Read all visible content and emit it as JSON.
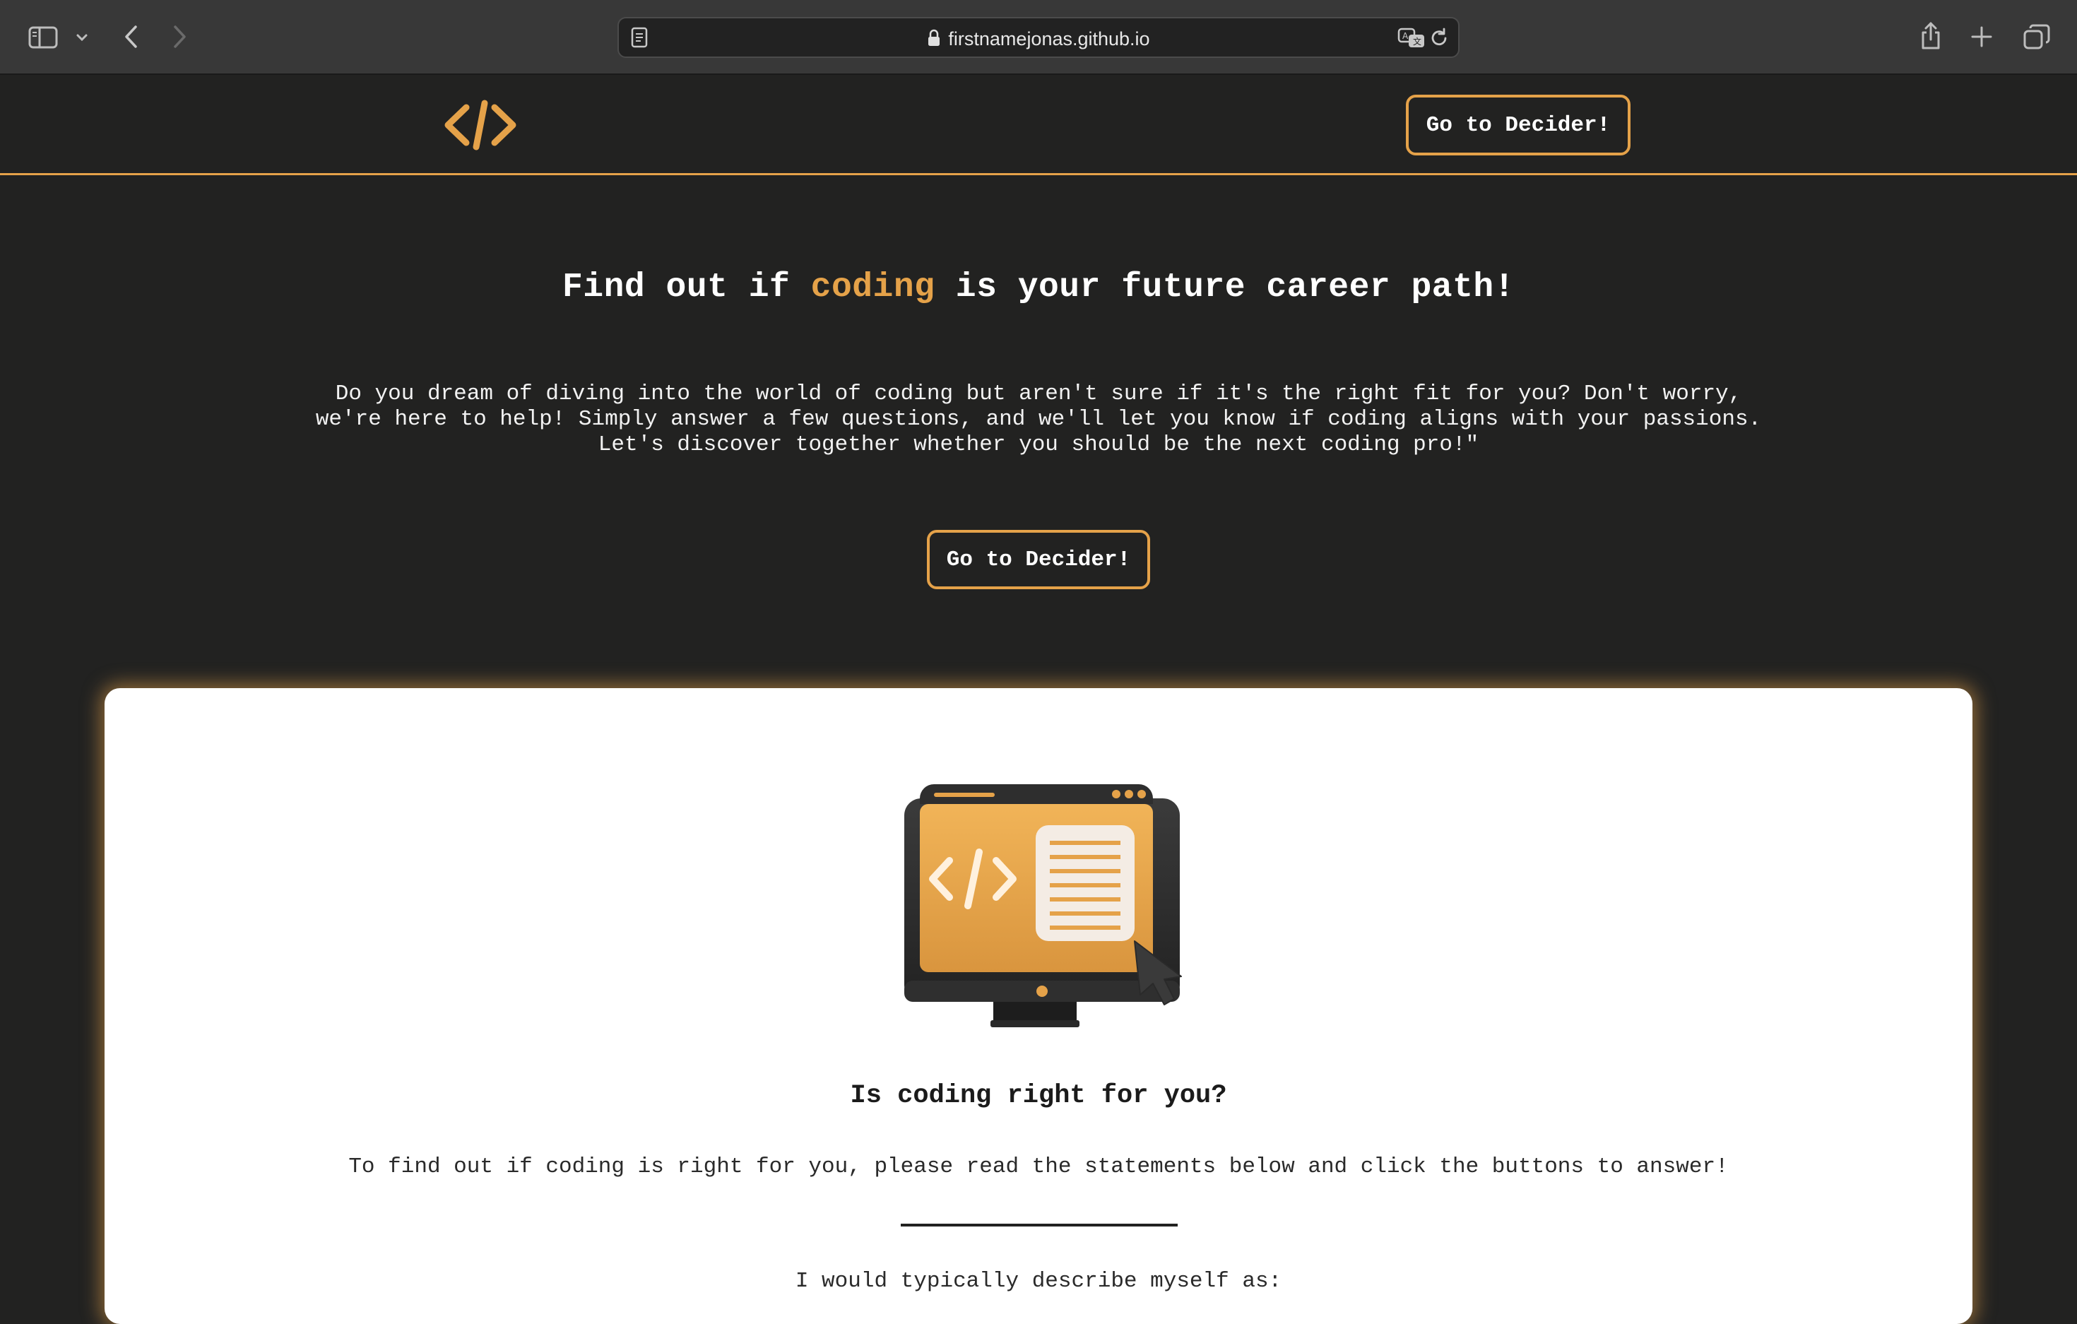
{
  "browser": {
    "url": "firstnamejonas.github.io",
    "icons": {
      "sidebar": "sidebar-icon",
      "sidebar_menu": "chevron-down-icon",
      "back": "back-arrow-icon",
      "forward": "forward-arrow-icon",
      "reader": "reader-icon",
      "lock": "lock-icon",
      "translate": "translate-icon",
      "reload": "reload-icon",
      "share": "share-icon",
      "new_tab": "plus-icon",
      "tab_overview": "tabs-icon"
    }
  },
  "header": {
    "logo": "code-brackets-logo",
    "cta_label": "Go to Decider!"
  },
  "hero": {
    "title_before": "Find out if ",
    "title_accent": "coding",
    "title_after": " is your future career path!",
    "text": "Do you dream of diving into the world of coding but aren't sure if it's the right fit for you? Don't worry,\nwe're here to help! Simply answer a few questions, and we'll let you know if coding aligns with your passions.\nLet's discover together whether you should be the next coding pro!\"",
    "cta_label": "Go to Decider!"
  },
  "card": {
    "illustration": "computer-monitor-code-illustration",
    "title": "Is coding right for you?",
    "instructions": "To find out if coding is right for you, please read the statements below and click the buttons to answer!",
    "question": "I would typically describe myself as:"
  },
  "colors": {
    "background": "#222221",
    "accent": "#e5a249",
    "text_light": "#ffffff",
    "card_bg": "#ffffff",
    "card_text": "#1b1b1b"
  }
}
